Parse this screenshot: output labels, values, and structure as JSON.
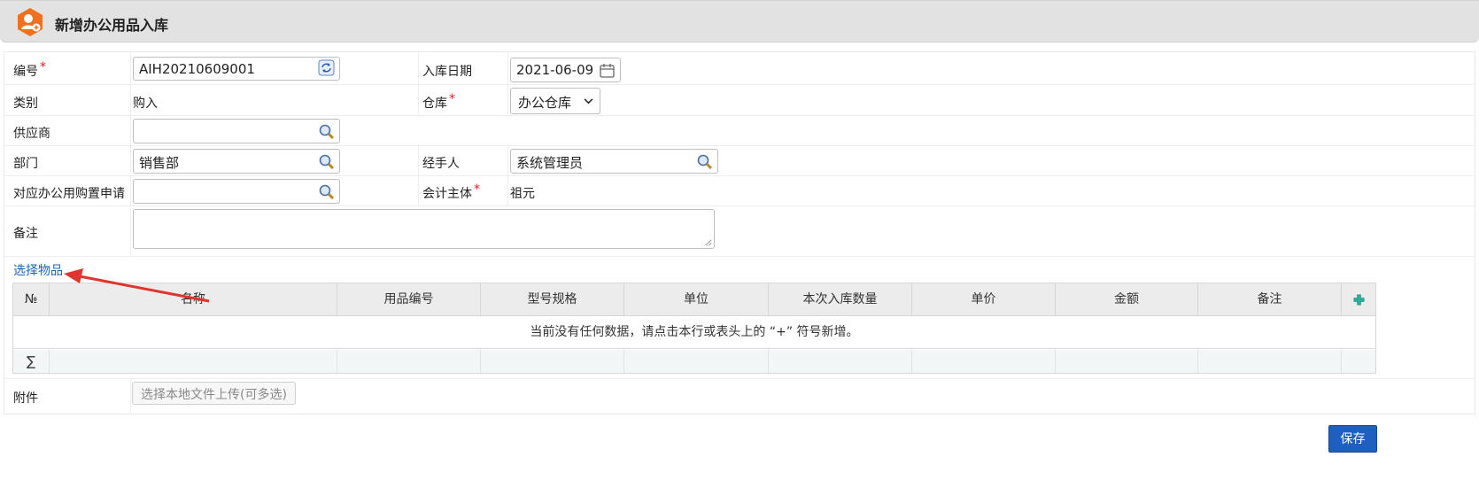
{
  "window": {
    "title": "新增办公用品入库"
  },
  "form": {
    "code_label": "编号",
    "code_value": "AIH20210609001",
    "date_label": "入库日期",
    "date_value": "2021-06-09",
    "category_label": "类别",
    "category_value": "购入",
    "warehouse_label": "仓库",
    "warehouse_value": "办公仓库",
    "supplier_label": "供应商",
    "supplier_value": "",
    "department_label": "部门",
    "department_value": "销售部",
    "handler_label": "经手人",
    "handler_value": "系统管理员",
    "purchase_request_label": "对应办公用购置申请",
    "purchase_request_value": "",
    "accounting_entity_label": "会计主体",
    "accounting_entity_value": "祖元",
    "remark_label": "备注",
    "required_mark": "*"
  },
  "items": {
    "select_link": "选择物品",
    "columns": [
      "№",
      "名称",
      "用品编号",
      "型号规格",
      "单位",
      "本次入库数量",
      "单价",
      "金额",
      "备注"
    ],
    "empty_message": "当前没有任何数据，请点击本行或表头上的 “+” 符号新增。",
    "sum_symbol": "∑"
  },
  "attachment": {
    "label": "附件",
    "upload_button": "选择本地文件上传(可多选)"
  },
  "actions": {
    "save_label": "保存"
  },
  "colors": {
    "accent": "#1e5fbf",
    "link": "#1a64b6",
    "required": "#e02020",
    "title_icon": "#f07020",
    "add_icon": "#2bb0a0"
  }
}
